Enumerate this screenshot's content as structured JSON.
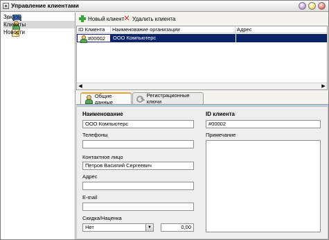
{
  "window": {
    "title": "Управление клиентами"
  },
  "sidebar": {
    "items": [
      {
        "label": "Заказы",
        "icon": "cart-icon"
      },
      {
        "label": "Клиенты",
        "icon": "clients-icon",
        "selected": true
      },
      {
        "label": "Новости",
        "icon": "news-icon"
      }
    ]
  },
  "toolbar": {
    "new_client": "Новый клиент",
    "delete_client": "Удалить клиента"
  },
  "grid": {
    "columns": [
      "ID Клиента",
      "Наименование организации",
      "Адрес"
    ],
    "rows": [
      {
        "id": "#00002",
        "name": "ООО Компьютерс",
        "address": ""
      }
    ]
  },
  "tabs": [
    {
      "label": "Общие данные",
      "active": true
    },
    {
      "label": "Регистрационные ключи",
      "active": false
    }
  ],
  "form": {
    "name_label": "Наименование",
    "name_value": "ООО Компьютерс",
    "phones_label": "Телефоны",
    "phones_value": "",
    "contact_label": "Контактное лицо",
    "contact_value": "Петров Василий Сергеевич",
    "address_label": "Адрес",
    "address_value": "",
    "email_label": "E-mail",
    "email_value": "",
    "discount_label": "Скидка/Наценка",
    "discount_value": "Нет",
    "discount_amount": "0,00",
    "client_id_label": "ID клиента",
    "client_id_value": "#00002",
    "notes_label": "Примечание",
    "notes_value": ""
  },
  "colors": {
    "selection": "#0a246a",
    "tab_accent": "#e6a33a",
    "tab_strip": "#b9cde8"
  }
}
